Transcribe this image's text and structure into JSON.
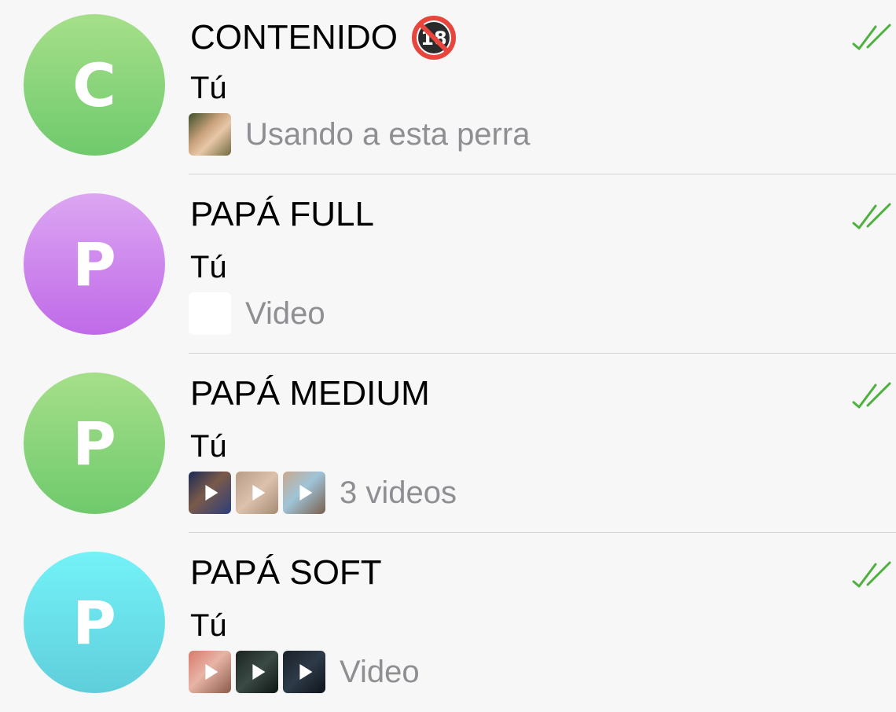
{
  "chats": [
    {
      "title": "CONTENIDO",
      "title_badge_icon": "no-under-18-icon",
      "avatar_letter": "C",
      "avatar_color": "green",
      "sender": "Tú",
      "preview_text": "Usando a esta perra",
      "status": "read-double-check",
      "check_color": "#4cb13d"
    },
    {
      "title": "PAPÁ FULL",
      "avatar_letter": "P",
      "avatar_color": "purple",
      "sender": "Tú",
      "preview_text": "Video",
      "status": "read-double-check",
      "check_color": "#4cb13d"
    },
    {
      "title": "PAPÁ MEDIUM",
      "avatar_letter": "P",
      "avatar_color": "green",
      "sender": "Tú",
      "preview_text": "3 videos",
      "status": "read-double-check",
      "check_color": "#4cb13d"
    },
    {
      "title": "PAPÁ SOFT",
      "avatar_letter": "P",
      "avatar_color": "cyan",
      "sender": "Tú",
      "preview_text": "Video",
      "status": "read-double-check",
      "check_color": "#4cb13d"
    }
  ]
}
